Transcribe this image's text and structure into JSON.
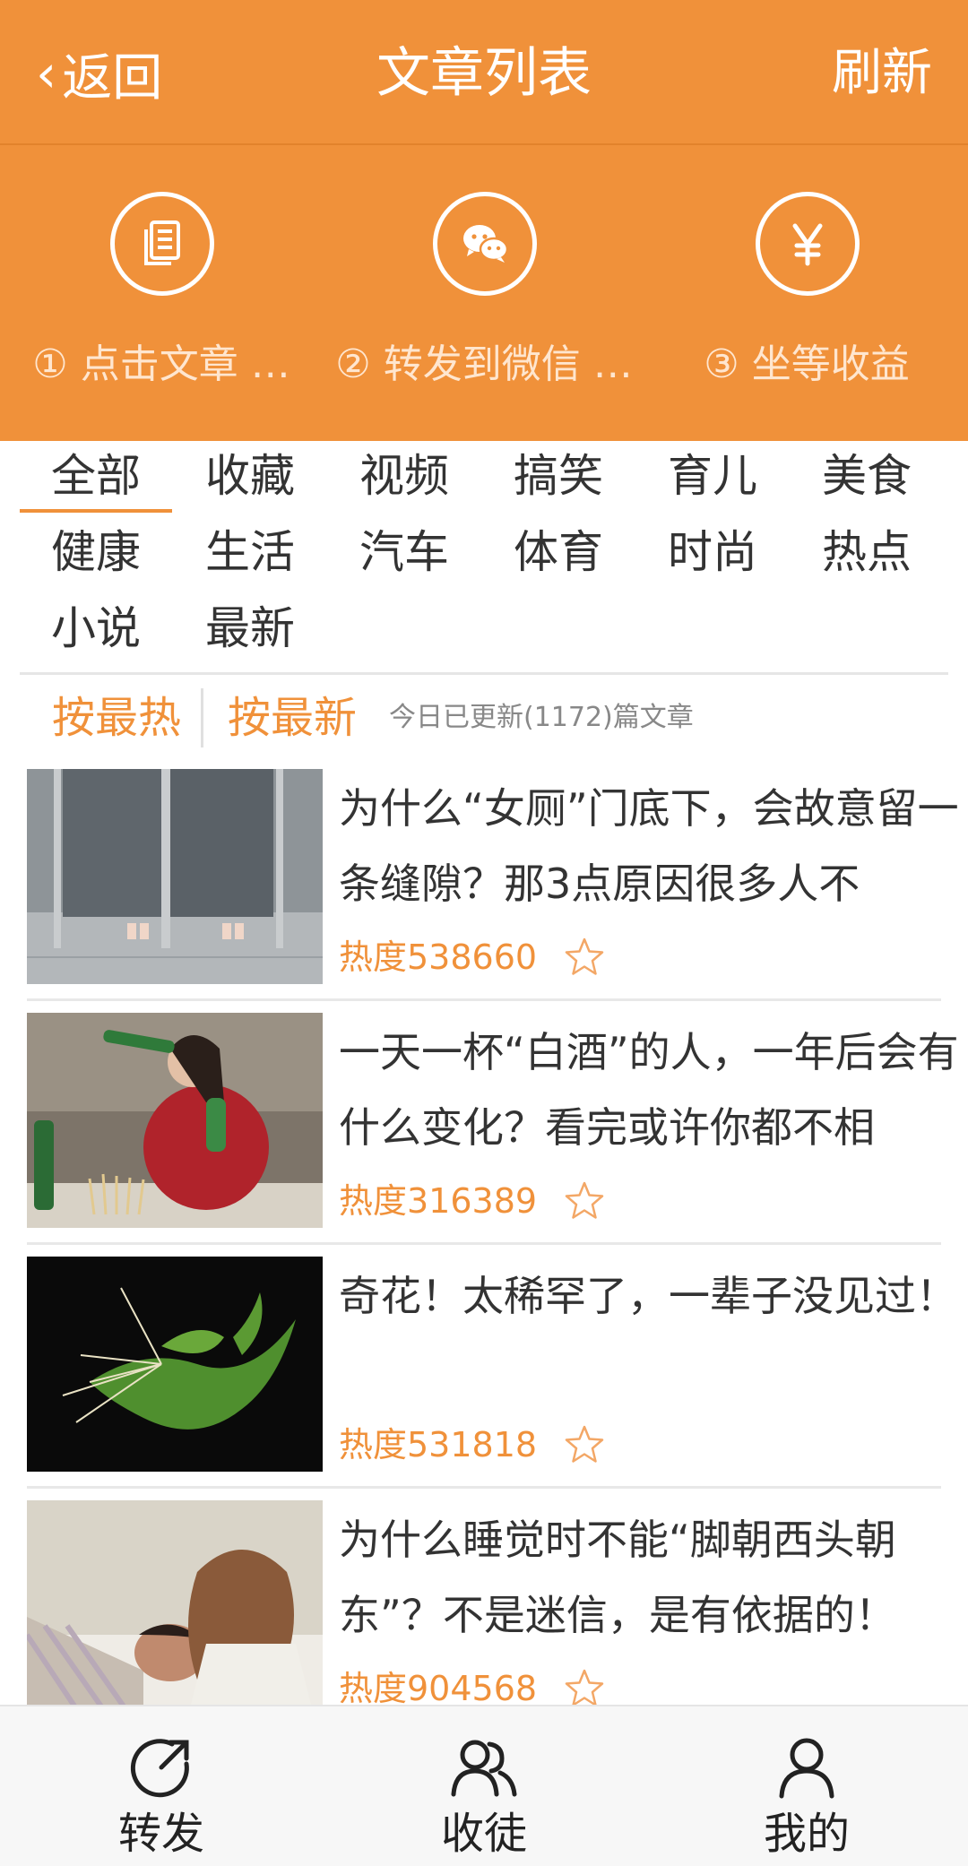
{
  "header": {
    "back_label": "返回",
    "title": "文章列表",
    "refresh_label": "刷新"
  },
  "steps": [
    {
      "label": "① 点击文章 …",
      "icon": "document-icon"
    },
    {
      "label": "② 转发到微信 …",
      "icon": "wechat-icon"
    },
    {
      "label": "③ 坐等收益",
      "icon": "yen-icon"
    }
  ],
  "categories": [
    "全部",
    "收藏",
    "视频",
    "搞笑",
    "育儿",
    "美食",
    "健康",
    "生活",
    "汽车",
    "体育",
    "时尚",
    "热点",
    "小说",
    "最新"
  ],
  "sort": {
    "hot_label": "按最热",
    "new_label": "按最新",
    "update_text": "今日已更新(1172)篇文章"
  },
  "articles": [
    {
      "title": "为什么“女厕”门底下，会故意留一条缝隙？那3点原因很多人不",
      "heat": "热度538660"
    },
    {
      "title": "一天一杯“白酒”的人，一年后会有什么变化？看完或许你都不相",
      "heat": "热度316389"
    },
    {
      "title": "奇花！太稀罕了，一辈子没见过！",
      "heat": "热度531818"
    },
    {
      "title": "为什么睡觉时不能“脚朝西头朝东”？不是迷信，是有依据的！",
      "heat": "热度904568"
    }
  ],
  "bottom_nav": [
    {
      "label": "转发",
      "icon": "share-icon"
    },
    {
      "label": "收徒",
      "icon": "users-icon"
    },
    {
      "label": "我的",
      "icon": "user-icon"
    }
  ],
  "colors": {
    "accent": "#f0913a"
  }
}
